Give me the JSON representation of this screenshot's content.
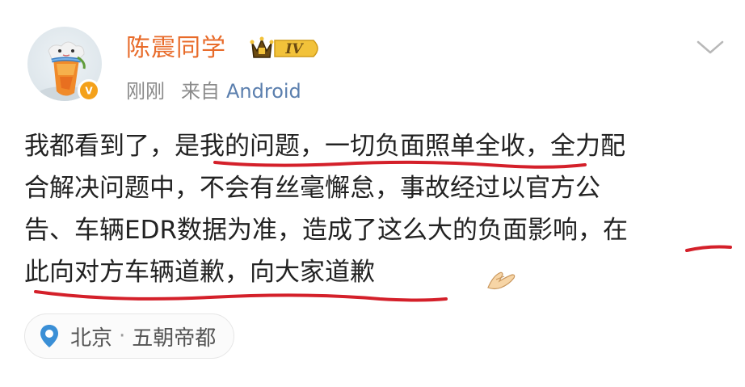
{
  "post": {
    "author": {
      "name": "陈震同学",
      "level_badge": "IV"
    },
    "meta": {
      "time": "刚刚",
      "from_label": "来自",
      "source": "Android"
    },
    "content_lines": [
      "我都看到了，是我的问题，一切负面照单全收，全力配",
      "合解决问题中，不会有丝毫懈怠，事故经过以官方公",
      "告、车辆EDR数据为准，造成了这么大的负面影响，在",
      "此向对方车辆道歉，向大家道歉"
    ],
    "location": {
      "city": "北京",
      "separator": "·",
      "area": "五朝帝都"
    }
  },
  "icons": {
    "more": "chevron-down-icon",
    "verified": "verified-badge-icon",
    "level": "crown-level-badge-icon",
    "location": "location-pin-icon",
    "emoji": "folded-hands-emoji"
  },
  "colors": {
    "author_name": "#e86b2a",
    "source_link": "#5b7fae",
    "meta_text": "#8a8a8a",
    "body_text": "#222222",
    "underline": "#d4202a",
    "location_pin": "#3a8fd6",
    "verified": "#f4a11a"
  }
}
